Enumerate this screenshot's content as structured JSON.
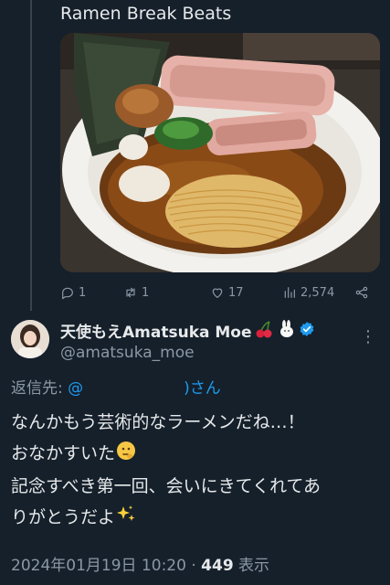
{
  "quoted_post": {
    "title": "Ramen Break Beats",
    "media_alt": "ramen-photo",
    "stats": {
      "replies": "1",
      "reposts": "1",
      "likes": "17",
      "views": "2,574"
    }
  },
  "post": {
    "display_name": "天使もえAmatsuka Moe",
    "handle": "@amatsuka_moe",
    "reply_to_label": "返信先:",
    "reply_to_mention_prefix": "@",
    "reply_to_suffix": ")さん",
    "lines": [
      "なんかもう芸術的なラーメンだね…！",
      "おなかすいた",
      "記念すべき第一回、会いにきてくれてあ",
      "りがとうだよ"
    ],
    "date": "2024年01月19日 10:20",
    "separator": " · ",
    "view_count": "449",
    "view_label": " 表示"
  },
  "icons": {
    "reply": "reply-icon",
    "repost": "repost-icon",
    "like": "heart-icon",
    "views": "views-icon",
    "share": "share-icon",
    "verified": "verified-badge-icon",
    "more": "more-options-icon"
  },
  "colors": {
    "background": "#15202b",
    "text": "#e7e9ea",
    "muted": "#8b98a5",
    "accent": "#1d9bf0"
  }
}
